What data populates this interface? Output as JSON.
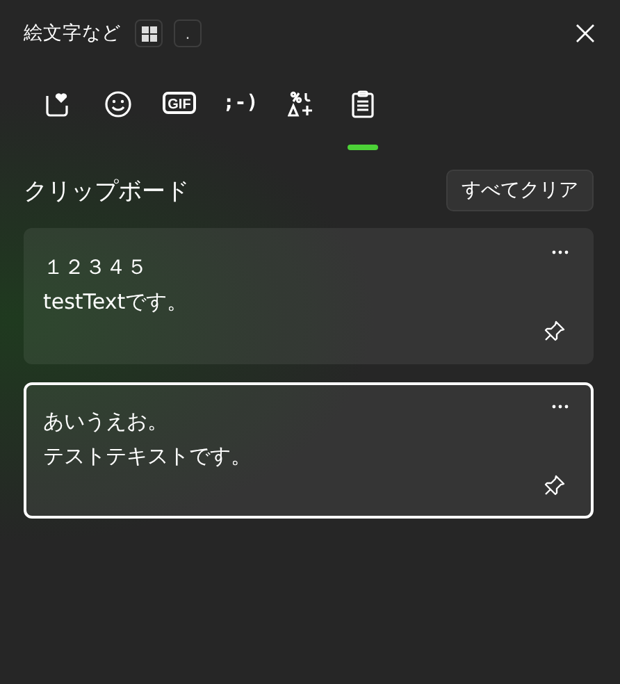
{
  "title": "絵文字など",
  "title_keys": [
    "."
  ],
  "tabs": [
    {
      "kind": "favorites",
      "selected": false
    },
    {
      "kind": "emoji",
      "selected": false
    },
    {
      "kind": "gif",
      "label": "GIF",
      "selected": false
    },
    {
      "kind": "kaomoji",
      "label": ";-)",
      "selected": false
    },
    {
      "kind": "symbols",
      "selected": false
    },
    {
      "kind": "clipboard",
      "selected": true
    }
  ],
  "section": {
    "heading": "クリップボード",
    "clear_button": "すべてクリア"
  },
  "items": [
    {
      "lines": [
        "１２３４５",
        "testTextです。"
      ],
      "selected": false
    },
    {
      "lines": [
        "あいうえお。",
        "テストテキストです。"
      ],
      "selected": true
    }
  ]
}
